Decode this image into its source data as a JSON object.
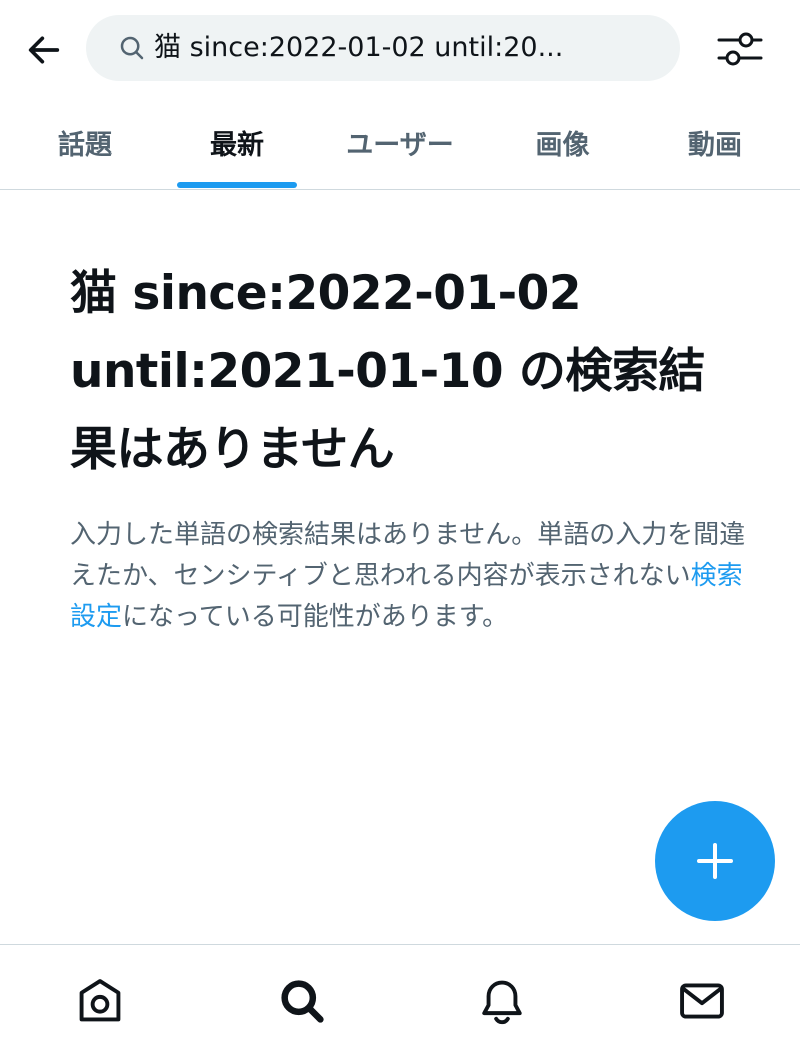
{
  "header": {
    "back_icon": "arrow-left-icon",
    "search": {
      "icon": "search-icon",
      "query": "猫 since:2022-01-02 until:20..."
    },
    "filter_icon": "sliders-icon"
  },
  "tabs": [
    {
      "label": "話題",
      "active": false
    },
    {
      "label": "最新",
      "active": true
    },
    {
      "label": "ユーザー",
      "active": false
    },
    {
      "label": "画像",
      "active": false
    },
    {
      "label": "動画",
      "active": false
    }
  ],
  "empty_state": {
    "title": "猫 since:2022-01-02 until:2021-01-10 の検索結果はありません",
    "body_before": "入力した単語の検索結果はありません。単語の入力を間違えたか、センシティブと思われる内容が表示されない",
    "body_link": "検索設定",
    "body_after": "になっている可能性があります。"
  },
  "fab": {
    "icon": "plus-icon"
  },
  "bottom_nav": [
    {
      "icon": "home-icon",
      "active": false
    },
    {
      "icon": "search-icon",
      "active": true
    },
    {
      "icon": "bell-icon",
      "active": false
    },
    {
      "icon": "mail-icon",
      "active": false
    }
  ],
  "colors": {
    "accent": "#1d9bf0",
    "text_primary": "#0f1419",
    "text_secondary": "#536471",
    "search_bg": "#eff3f4",
    "divider": "#cfd9de"
  }
}
